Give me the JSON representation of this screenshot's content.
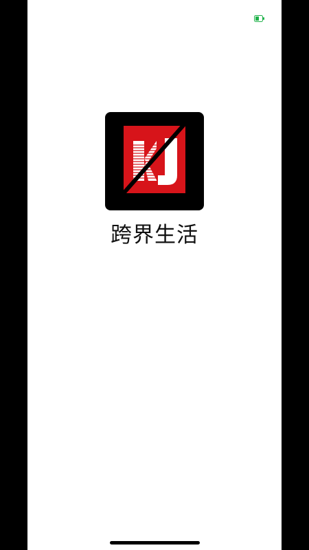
{
  "status_bar": {
    "indicator_icon": "battery-charging-icon",
    "indicator_color": "#20b24a"
  },
  "splash": {
    "logo_icon": "kj-logo-icon",
    "logo_text": "KJ",
    "app_name": "跨界生活",
    "logo_bg_color": "#000000",
    "logo_accent_color": "#d7141a"
  }
}
